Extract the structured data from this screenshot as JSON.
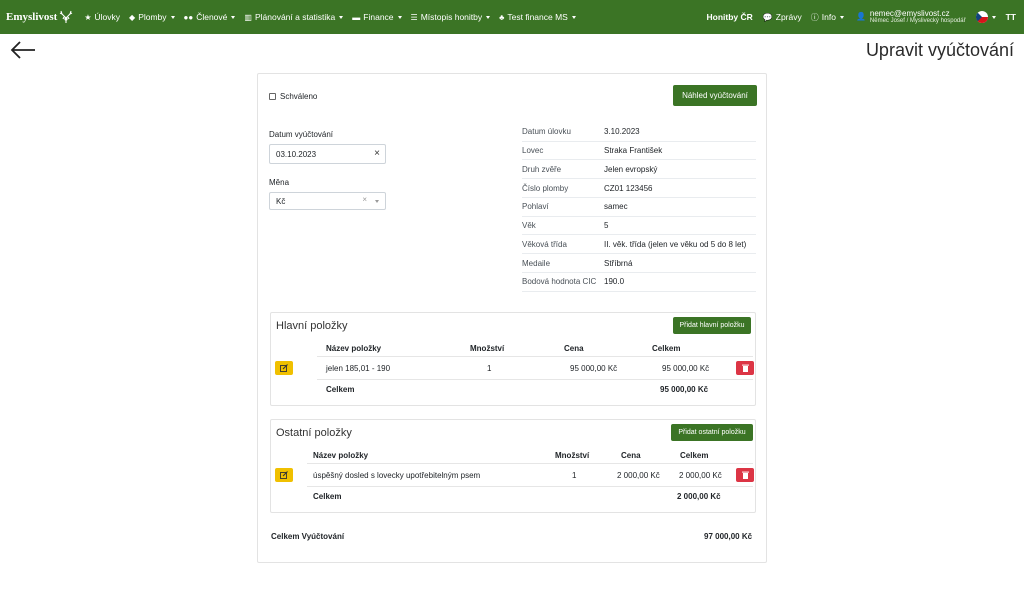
{
  "navbar": {
    "brand": "Emyslivost",
    "items": [
      {
        "label": "Úlovky",
        "icon": "star-icon",
        "caret": false
      },
      {
        "label": "Plomby",
        "icon": "tag-icon",
        "caret": true
      },
      {
        "label": "Členové",
        "icon": "users-icon",
        "caret": true
      },
      {
        "label": "Plánování a statistika",
        "icon": "chart-icon",
        "caret": true
      },
      {
        "label": "Finance",
        "icon": "money-icon",
        "caret": true
      },
      {
        "label": "Místopis honitby",
        "icon": "signpost-icon",
        "caret": true
      },
      {
        "label": "Test finance MS",
        "icon": "tree-icon",
        "caret": true
      }
    ],
    "right": {
      "hunting": "Honitby ČR",
      "messages": "Zprávy",
      "info": "Info",
      "user_email": "nemec@emyslivost.cz",
      "user_sub": "Němec Josef / Myslivecký hospodář",
      "text_size": "TT"
    }
  },
  "page": {
    "title": "Upravit vyúčtování"
  },
  "form": {
    "approved_label": "Schváleno",
    "preview_button": "Náhled vyúčtování",
    "date_label": "Datum vyúčtování",
    "date_value": "03.10.2023",
    "currency_label": "Měna",
    "currency_value": "Kč"
  },
  "details": [
    {
      "label": "Datum úlovku",
      "value": "3.10.2023"
    },
    {
      "label": "Lovec",
      "value": "Straka František"
    },
    {
      "label": "Druh zvěře",
      "value": "Jelen evropský"
    },
    {
      "label": "Číslo plomby",
      "value": "CZ01 123456"
    },
    {
      "label": "Pohlaví",
      "value": "samec"
    },
    {
      "label": "Věk",
      "value": "5"
    },
    {
      "label": "Věková třída",
      "value": "II. věk. třída (jelen ve věku od 5 do 8 let)"
    },
    {
      "label": "Medaile",
      "value": "Stříbrná"
    },
    {
      "label": "Bodová hodnota CIC",
      "value": "190.0"
    }
  ],
  "main_items": {
    "title": "Hlavní položky",
    "add_button": "Přidat hlavní položku",
    "headers": {
      "name": "Název položky",
      "qty": "Množství",
      "price": "Cena",
      "total": "Celkem"
    },
    "row": {
      "name": "jelen 185,01 - 190",
      "qty": "1",
      "price": "95 000,00 Kč",
      "total": "95 000,00 Kč"
    },
    "sum_label": "Celkem",
    "sum_value": "95 000,00 Kč"
  },
  "other_items": {
    "title": "Ostatní položky",
    "add_button": "Přidat ostatní položku",
    "headers": {
      "name": "Název položky",
      "qty": "Množství",
      "price": "Cena",
      "total": "Celkem"
    },
    "row": {
      "name": "úspěšný dosled s lovecky upotřebitelným psem",
      "qty": "1",
      "price": "2 000,00 Kč",
      "total": "2 000,00 Kč"
    },
    "sum_label": "Celkem",
    "sum_value": "2 000,00 Kč"
  },
  "grand_total": {
    "label": "Celkem Vyúčtování",
    "value": "97 000,00 Kč"
  },
  "colors": {
    "brand_green": "#3b7425",
    "edit_yellow": "#f0c000",
    "delete_red": "#dc3545"
  }
}
